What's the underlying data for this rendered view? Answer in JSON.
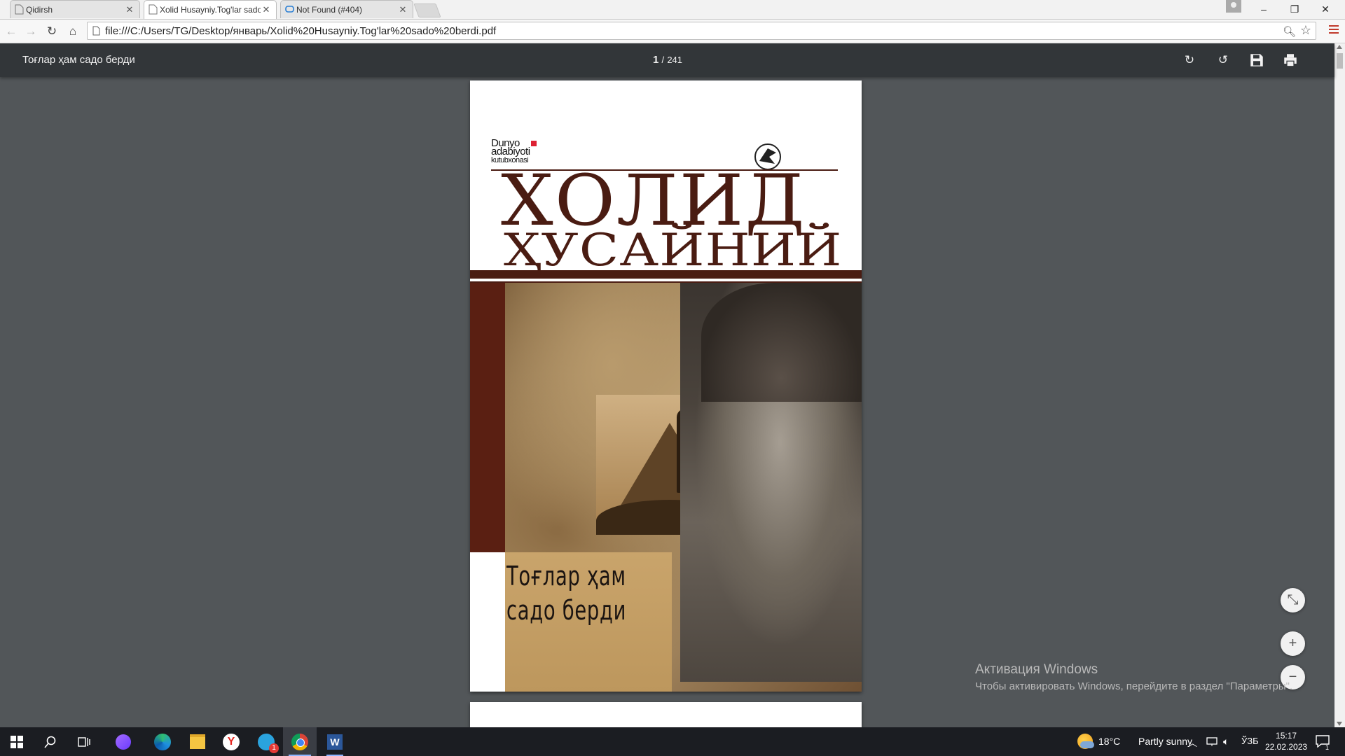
{
  "browser": {
    "tabs": [
      {
        "title": "Qidirsh",
        "active": false
      },
      {
        "title": "Xolid Husayniy.Tog'lar sado",
        "active": true
      },
      {
        "title": "Not Found (#404)",
        "active": false
      }
    ],
    "url": "file:///C:/Users/TG/Desktop/январь/Xolid%20Husayniy.Tog'lar%20sado%20berdi.pdf",
    "window_controls": {
      "minimize": "–",
      "restore": "❐",
      "close": "✕"
    }
  },
  "pdf_viewer": {
    "document_title": "Тоғлар ҳам садо берди",
    "current_page": "1",
    "page_separator": "/",
    "total_pages": "241",
    "tools": {
      "rotate_cw": "↻",
      "rotate_ccw": "↺",
      "save": "💾",
      "print": "🖶"
    },
    "zoom_controls": {
      "fit": "⤡",
      "zoom_in": "+",
      "zoom_out": "−"
    }
  },
  "cover": {
    "publisher_line1": "Dunyo",
    "publisher_line2": "adabiyoti",
    "publisher_line3": "kutubxonasi",
    "author_line1": "ХОЛИД",
    "author_line2": "ҲУСАЙНИЙ",
    "title_line1": "Тоғлар ҳам",
    "title_line2": "садо берди",
    "colors": {
      "brand_brown": "#4a1c12",
      "title_box": "#c9a46b"
    }
  },
  "watermark": {
    "line1": "Активация Windows",
    "line2": "Чтобы активировать Windows, перейдите в раздел \"Параметры\"."
  },
  "taskbar": {
    "weather_temp": "18°C",
    "weather_desc": "Partly sunny",
    "language": "ЎЗБ",
    "time": "15:17",
    "date": "22.02.2023",
    "notification_count": "1",
    "telegram_badge": "1"
  }
}
